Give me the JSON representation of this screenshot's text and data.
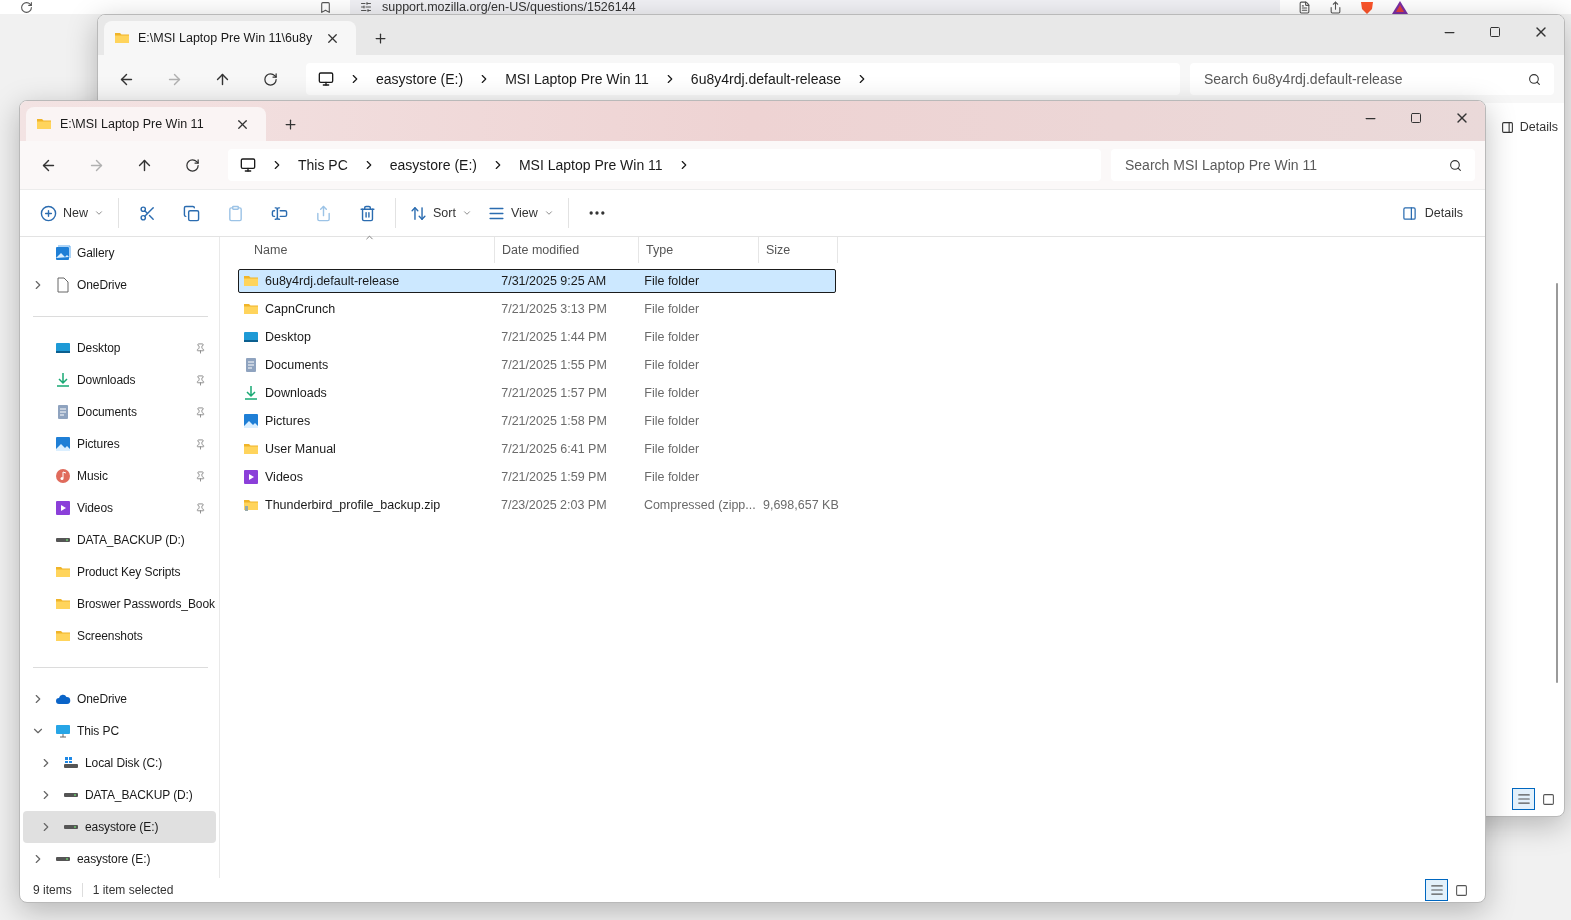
{
  "browser": {
    "url": "support.mozilla.org/en-US/questions/1526144"
  },
  "back_window": {
    "tab_title": "E:\\MSI Laptop Pre Win 11\\6u8y",
    "breadcrumbs": [
      "easystore (E:)",
      "MSI Laptop Pre Win 11",
      "6u8y4rdj.default-release"
    ],
    "search_placeholder": "Search 6u8y4rdj.default-release",
    "details_label": "Details",
    "view_modes": [
      {
        "kind": "details",
        "selected": true
      },
      {
        "kind": "tiles",
        "selected": false
      }
    ]
  },
  "front_window": {
    "tab_title": "E:\\MSI Laptop Pre Win 11",
    "breadcrumbs": [
      "This PC",
      "easystore (E:)",
      "MSI Laptop Pre Win 11"
    ],
    "search_placeholder": "Search MSI Laptop Pre Win 11",
    "toolbar": [
      {
        "kind": "new",
        "label": "New",
        "disabled": false
      },
      {
        "kind": "cut",
        "disabled": false
      },
      {
        "kind": "copy",
        "disabled": false
      },
      {
        "kind": "paste",
        "disabled": true
      },
      {
        "kind": "rename",
        "disabled": false
      },
      {
        "kind": "share",
        "disabled": true
      },
      {
        "kind": "delete",
        "disabled": false
      },
      {
        "kind": "sort",
        "label": "Sort",
        "disabled": false
      },
      {
        "kind": "view",
        "label": "View",
        "disabled": false
      },
      {
        "kind": "more",
        "disabled": false
      }
    ],
    "details_label": "Details",
    "sidebar": {
      "sections": [
        {
          "items": [
            {
              "label": "Gallery",
              "kind": "gallery",
              "selected": false
            },
            {
              "label": "OneDrive",
              "kind": "file",
              "expanded": false,
              "selected": false
            }
          ]
        },
        {
          "items": [
            {
              "label": "Desktop",
              "kind": "desktop",
              "pinned": true,
              "selected": false
            },
            {
              "label": "Downloads",
              "kind": "downloads",
              "pinned": true,
              "selected": false
            },
            {
              "label": "Documents",
              "kind": "documents",
              "pinned": true,
              "selected": false
            },
            {
              "label": "Pictures",
              "kind": "pictures",
              "pinned": true,
              "selected": false
            },
            {
              "label": "Music",
              "kind": "music",
              "pinned": true,
              "selected": false
            },
            {
              "label": "Videos",
              "kind": "videos",
              "pinned": true,
              "selected": false
            },
            {
              "label": "DATA_BACKUP (D:)",
              "kind": "drive",
              "pinned": false,
              "selected": false
            },
            {
              "label": "Product Key Scripts",
              "kind": "folder",
              "pinned": false,
              "selected": false
            },
            {
              "label": "Broswer Passwords_Book",
              "kind": "folder",
              "pinned": false,
              "selected": false
            },
            {
              "label": "Screenshots",
              "kind": "folder",
              "pinned": false,
              "selected": false
            }
          ]
        },
        {
          "items": [
            {
              "label": "OneDrive",
              "kind": "cloud",
              "expanded": false,
              "selected": false
            },
            {
              "label": "This PC",
              "kind": "pc",
              "expanded": true,
              "selected": false,
              "children": [
                {
                  "label": "Local Disk (C:)",
                  "kind": "system-drive",
                  "expanded": false,
                  "selected": false
                },
                {
                  "label": "DATA_BACKUP (D:)",
                  "kind": "drive",
                  "expanded": false,
                  "selected": false
                },
                {
                  "label": "easystore (E:)",
                  "kind": "drive",
                  "expanded": false,
                  "selected": true
                }
              ]
            },
            {
              "label": "easystore (E:)",
              "kind": "drive",
              "expanded": false,
              "selected": false
            }
          ]
        }
      ]
    },
    "columns": [
      "Name",
      "Date modified",
      "Type",
      "Size"
    ],
    "rows": [
      {
        "name": "6u8y4rdj.default-release",
        "date": "7/31/2025 9:25 AM",
        "type": "File folder",
        "kind": "folder",
        "selected": true
      },
      {
        "name": "CapnCrunch",
        "date": "7/21/2025 3:13 PM",
        "type": "File folder",
        "kind": "folder",
        "selected": false
      },
      {
        "name": "Desktop",
        "date": "7/21/2025 1:44 PM",
        "type": "File folder",
        "kind": "desktop",
        "selected": false
      },
      {
        "name": "Documents",
        "date": "7/21/2025 1:55 PM",
        "type": "File folder",
        "kind": "documents",
        "selected": false
      },
      {
        "name": "Downloads",
        "date": "7/21/2025 1:57 PM",
        "type": "File folder",
        "kind": "downloads",
        "selected": false
      },
      {
        "name": "Pictures",
        "date": "7/21/2025 1:58 PM",
        "type": "File folder",
        "kind": "pictures",
        "selected": false
      },
      {
        "name": "User Manual",
        "date": "7/21/2025 6:41 PM",
        "type": "File folder",
        "kind": "folder",
        "selected": false
      },
      {
        "name": "Videos",
        "date": "7/21/2025 1:59 PM",
        "type": "File folder",
        "kind": "videos",
        "selected": false
      },
      {
        "name": "Thunderbird_profile_backup.zip",
        "date": "7/23/2025 2:03 PM",
        "type": "Compressed (zipp...",
        "size": "9,698,657 KB",
        "kind": "zip",
        "selected": false
      }
    ],
    "status": {
      "count": "9 items",
      "selection": "1 item selected"
    },
    "view_modes": [
      {
        "kind": "details",
        "selected": true
      },
      {
        "kind": "tiles",
        "selected": false
      }
    ]
  }
}
